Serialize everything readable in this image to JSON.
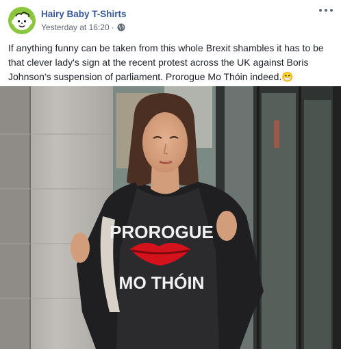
{
  "post": {
    "page_name": "Hairy Baby T-Shirts",
    "timestamp": "Yesterday at 16:20",
    "separator": "·",
    "privacy_icon": "globe-icon",
    "more_icon": "more-options-icon",
    "text": "If anything funny can be taken from this whole Brexit shambles it has to be that clever lady's sign at the recent protest across the UK against Boris Johnson's suspension of parliament. Prorogue Mo Thóin indeed.",
    "emoji": "😁"
  },
  "image": {
    "shirt_line1": "PROROGUE",
    "shirt_line2": "MO THÓIN"
  },
  "colors": {
    "link": "#365899",
    "avatar_green": "#8cc63f",
    "lips_red": "#d3121c",
    "shirt": "#2b2b2e"
  }
}
